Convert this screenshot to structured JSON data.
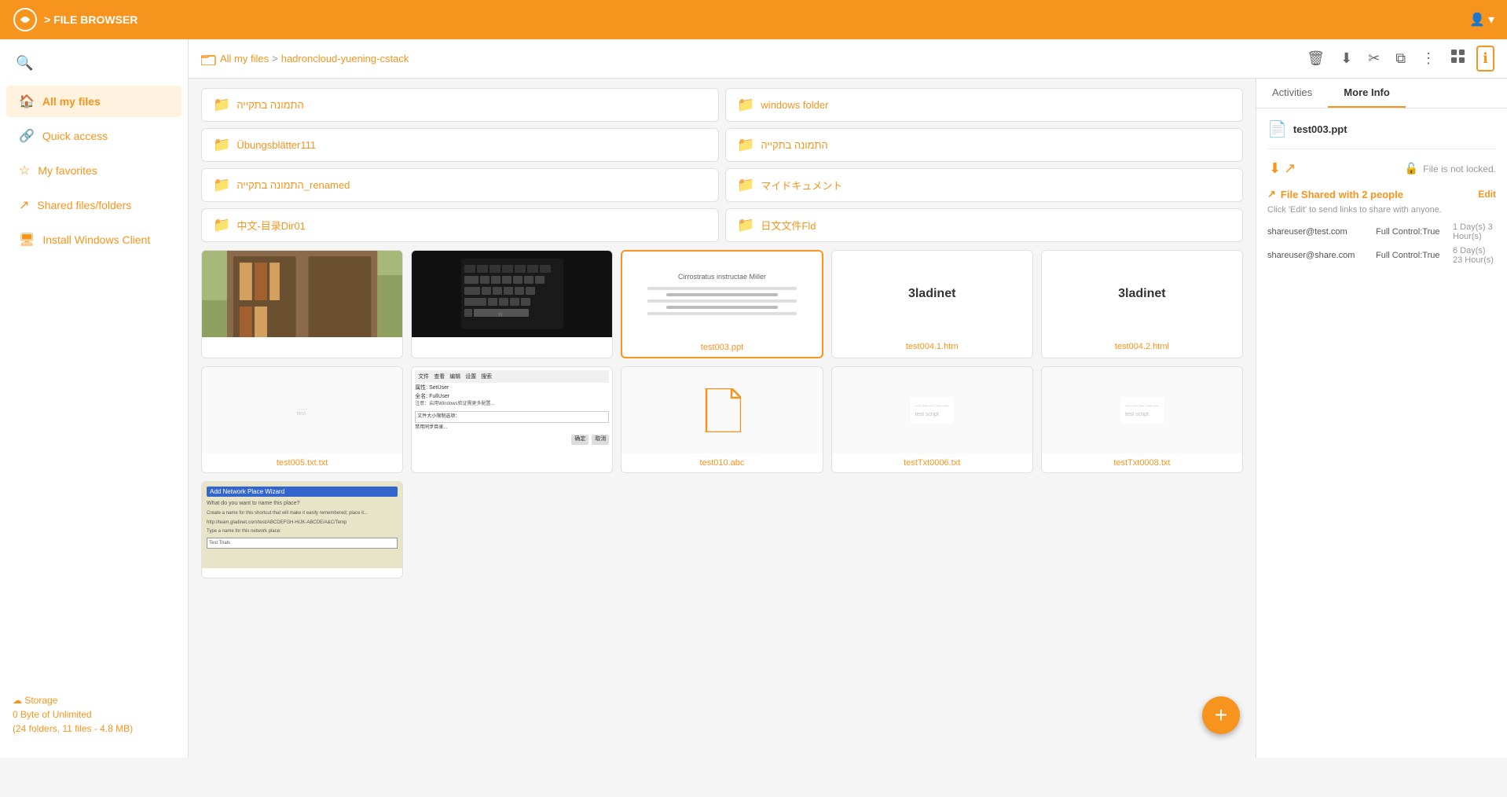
{
  "header": {
    "logo_text": "> FILE BROWSER",
    "user_icon": "👤"
  },
  "breadcrumb": {
    "root": "All my files",
    "separator": ">",
    "path": "hadroncloud-yuening-cstack"
  },
  "toolbar": {
    "delete_label": "🗑",
    "download_label": "⬇",
    "cut_label": "✂",
    "copy_label": "⧉",
    "more_label": "⋮",
    "grid_label": "⊞",
    "info_label": "ℹ"
  },
  "sidebar": {
    "search_placeholder": "Search",
    "items": [
      {
        "id": "all-my-files",
        "label": "All my files",
        "icon": "🏠",
        "active": true
      },
      {
        "id": "quick-access",
        "label": "Quick access",
        "icon": "🔗"
      },
      {
        "id": "my-favorites",
        "label": "My favorites",
        "icon": "☆"
      },
      {
        "id": "shared-files",
        "label": "Shared files/folders",
        "icon": "↗"
      },
      {
        "id": "install-windows",
        "label": "Install Windows Client",
        "icon": "🖥"
      }
    ],
    "storage_label": "Storage",
    "storage_detail": "0 Byte of Unlimited",
    "storage_info": "(24 folders, 11 files - 4.8 MB)"
  },
  "folders": [
    {
      "name": "התמונה בתקייה"
    },
    {
      "name": "windows folder"
    },
    {
      "name": "Übungsblätter111"
    },
    {
      "name": "התמונה בתקייה"
    },
    {
      "name": "התמונה בתקייה_renamed"
    },
    {
      "name": "マイドキュメント"
    },
    {
      "name": "中文-目录Dir01"
    },
    {
      "name": "日文文件Fld"
    }
  ],
  "files": [
    {
      "id": "photo1",
      "name": "",
      "type": "photo",
      "selected": false
    },
    {
      "id": "photo2",
      "name": "",
      "type": "keyboard",
      "selected": false
    },
    {
      "id": "test003",
      "name": "test003.ppt",
      "type": "ppt",
      "selected": true
    },
    {
      "id": "test004_1",
      "name": "test004.1.htm",
      "type": "gladinet",
      "selected": false
    },
    {
      "id": "test004_2",
      "name": "test004.2.html",
      "type": "gladinet",
      "selected": false
    },
    {
      "id": "test005",
      "name": "test005.txt.txt",
      "type": "txt_blank",
      "selected": false
    },
    {
      "id": "test_chinese",
      "name": "",
      "type": "chinese_dialog",
      "selected": false
    },
    {
      "id": "test010",
      "name": "test010.abc",
      "type": "file_icon",
      "selected": false
    },
    {
      "id": "testTxt6",
      "name": "testTxt0006.txt",
      "type": "txt_content",
      "selected": false
    },
    {
      "id": "testTxt8",
      "name": "testTxt0008.txt",
      "type": "txt_content",
      "selected": false
    },
    {
      "id": "dialog_img",
      "name": "",
      "type": "dialog",
      "selected": false
    }
  ],
  "info_panel": {
    "tab_activities": "Activities",
    "tab_more_info": "More Info",
    "active_tab": "More Info",
    "file_name": "test003.ppt",
    "download_btn": "⬇",
    "share_btn": "↗",
    "lock_status": "File is not locked.",
    "lock_icon": "🔓",
    "share_section_title": "File Shared with 2 people",
    "share_edit_label": "Edit",
    "share_subtitle": "Click 'Edit' to send links to share with anyone.",
    "shares": [
      {
        "email": "shareuser@test.com",
        "permission": "Full Control:True",
        "time": "1 Day(s) 3 Hour(s)"
      },
      {
        "email": "shareuser@share.com",
        "permission": "Full Control:True",
        "time": "6 Day(s) 23 Hour(s)"
      }
    ]
  },
  "fab": {
    "label": "+"
  }
}
